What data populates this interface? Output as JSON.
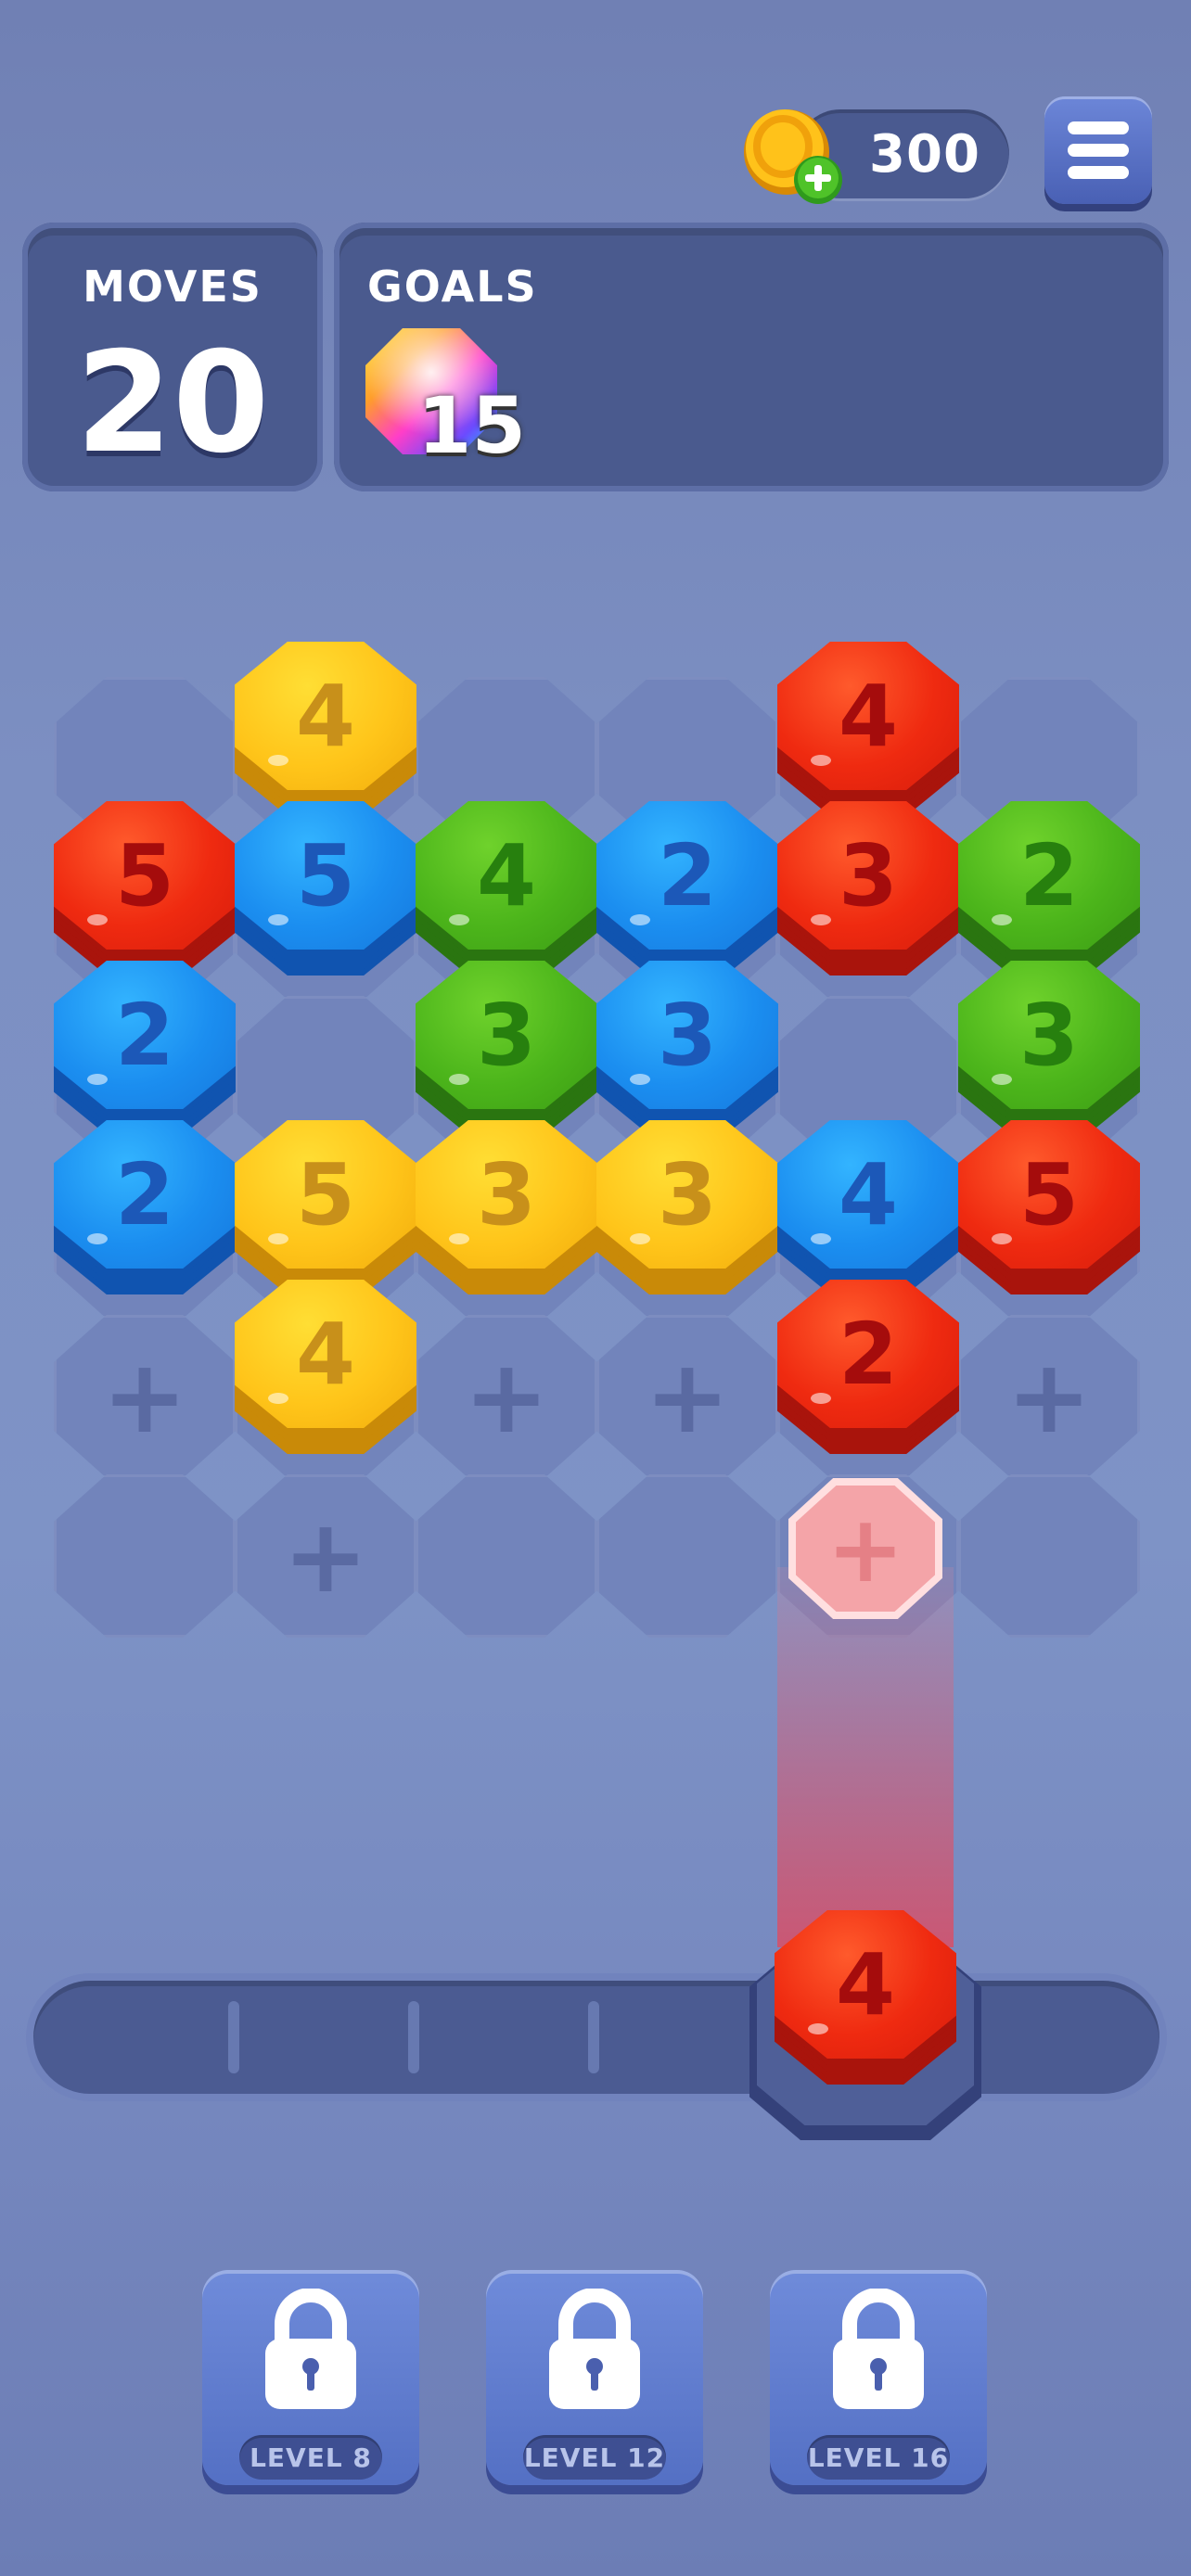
{
  "hud": {
    "coins": "300",
    "moves_label": "MOVES",
    "moves_value": "20",
    "goals_label": "GOALS",
    "goal_count": "15",
    "goal_icon": "rainbow-gem-icon"
  },
  "board": {
    "columns": 6,
    "rows": 6,
    "tiles": [
      {
        "col": 1,
        "row": 0,
        "color": "yellow",
        "label": "4"
      },
      {
        "col": 4,
        "row": 0,
        "color": "red",
        "label": "4"
      },
      {
        "col": 0,
        "row": 1,
        "color": "red",
        "label": "5"
      },
      {
        "col": 1,
        "row": 1,
        "color": "blue",
        "label": "5"
      },
      {
        "col": 2,
        "row": 1,
        "color": "green",
        "label": "4"
      },
      {
        "col": 3,
        "row": 1,
        "color": "blue",
        "label": "2"
      },
      {
        "col": 4,
        "row": 1,
        "color": "red",
        "label": "3"
      },
      {
        "col": 5,
        "row": 1,
        "color": "green",
        "label": "2"
      },
      {
        "col": 0,
        "row": 2,
        "color": "blue",
        "label": "2"
      },
      {
        "col": 2,
        "row": 2,
        "color": "green",
        "label": "3"
      },
      {
        "col": 3,
        "row": 2,
        "color": "blue",
        "label": "3"
      },
      {
        "col": 5,
        "row": 2,
        "color": "green",
        "label": "3"
      },
      {
        "col": 0,
        "row": 3,
        "color": "blue",
        "label": "2"
      },
      {
        "col": 1,
        "row": 3,
        "color": "yellow",
        "label": "5"
      },
      {
        "col": 2,
        "row": 3,
        "color": "yellow",
        "label": "3"
      },
      {
        "col": 3,
        "row": 3,
        "color": "yellow",
        "label": "3"
      },
      {
        "col": 4,
        "row": 3,
        "color": "blue",
        "label": "4"
      },
      {
        "col": 5,
        "row": 3,
        "color": "red",
        "label": "5"
      },
      {
        "col": 1,
        "row": 4,
        "color": "yellow",
        "label": "4"
      },
      {
        "col": 4,
        "row": 4,
        "color": "red",
        "label": "2"
      }
    ],
    "plus_cells": [
      {
        "col": 0,
        "row": 4
      },
      {
        "col": 2,
        "row": 4
      },
      {
        "col": 3,
        "row": 4
      },
      {
        "col": 5,
        "row": 4
      },
      {
        "col": 1,
        "row": 5
      }
    ],
    "target_cell": {
      "col": 4,
      "row": 5,
      "icon": "plus-icon"
    }
  },
  "tray": {
    "held_tile": {
      "color": "red",
      "label": "4"
    }
  },
  "levels": [
    {
      "label": "LEVEL 8",
      "locked": true
    },
    {
      "label": "LEVEL 12",
      "locked": true
    },
    {
      "label": "LEVEL 16",
      "locked": true
    }
  ],
  "colors": {
    "red": "#ef2a10",
    "blue": "#1b8ef0",
    "green": "#4cb51b",
    "yellow": "#ffc51a",
    "panel": "#4a5a8e",
    "background": "#7e93c6"
  }
}
